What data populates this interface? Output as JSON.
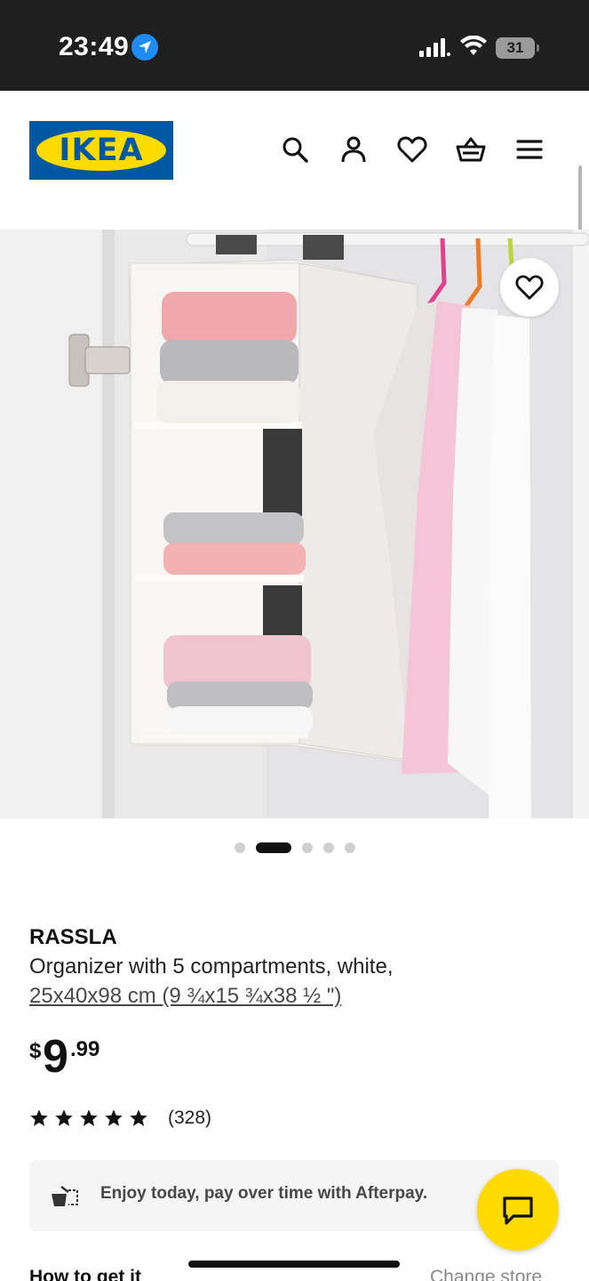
{
  "status_bar": {
    "time": "23:49",
    "battery": "31",
    "icons": [
      "location-arrow-icon",
      "signal-icon",
      "wifi-icon",
      "battery-icon"
    ]
  },
  "header": {
    "logo_text": "IKEA",
    "icons": [
      "search-icon",
      "account-icon",
      "heart-icon",
      "basket-icon",
      "menu-icon"
    ]
  },
  "gallery": {
    "image_count": 5,
    "active_index": 1
  },
  "product": {
    "name": "RASSLA",
    "description": "Organizer with 5 compartments, white,",
    "dimensions": "25x40x98 cm (9 ¾x15 ¾x38 ½ \")",
    "price": {
      "currency": "$",
      "integer": "9",
      "decimal": ".99"
    },
    "rating": {
      "stars": 5,
      "count": "(328)"
    }
  },
  "afterpay": {
    "text": "Enjoy today, pay over time with Afterpay."
  },
  "footer": {
    "how_to_get": "How to get it",
    "change_store": "Change store"
  },
  "colors": {
    "brand_blue": "#0058a3",
    "brand_yellow": "#ffdb00",
    "status_bar_bg": "#1f1f1f"
  }
}
